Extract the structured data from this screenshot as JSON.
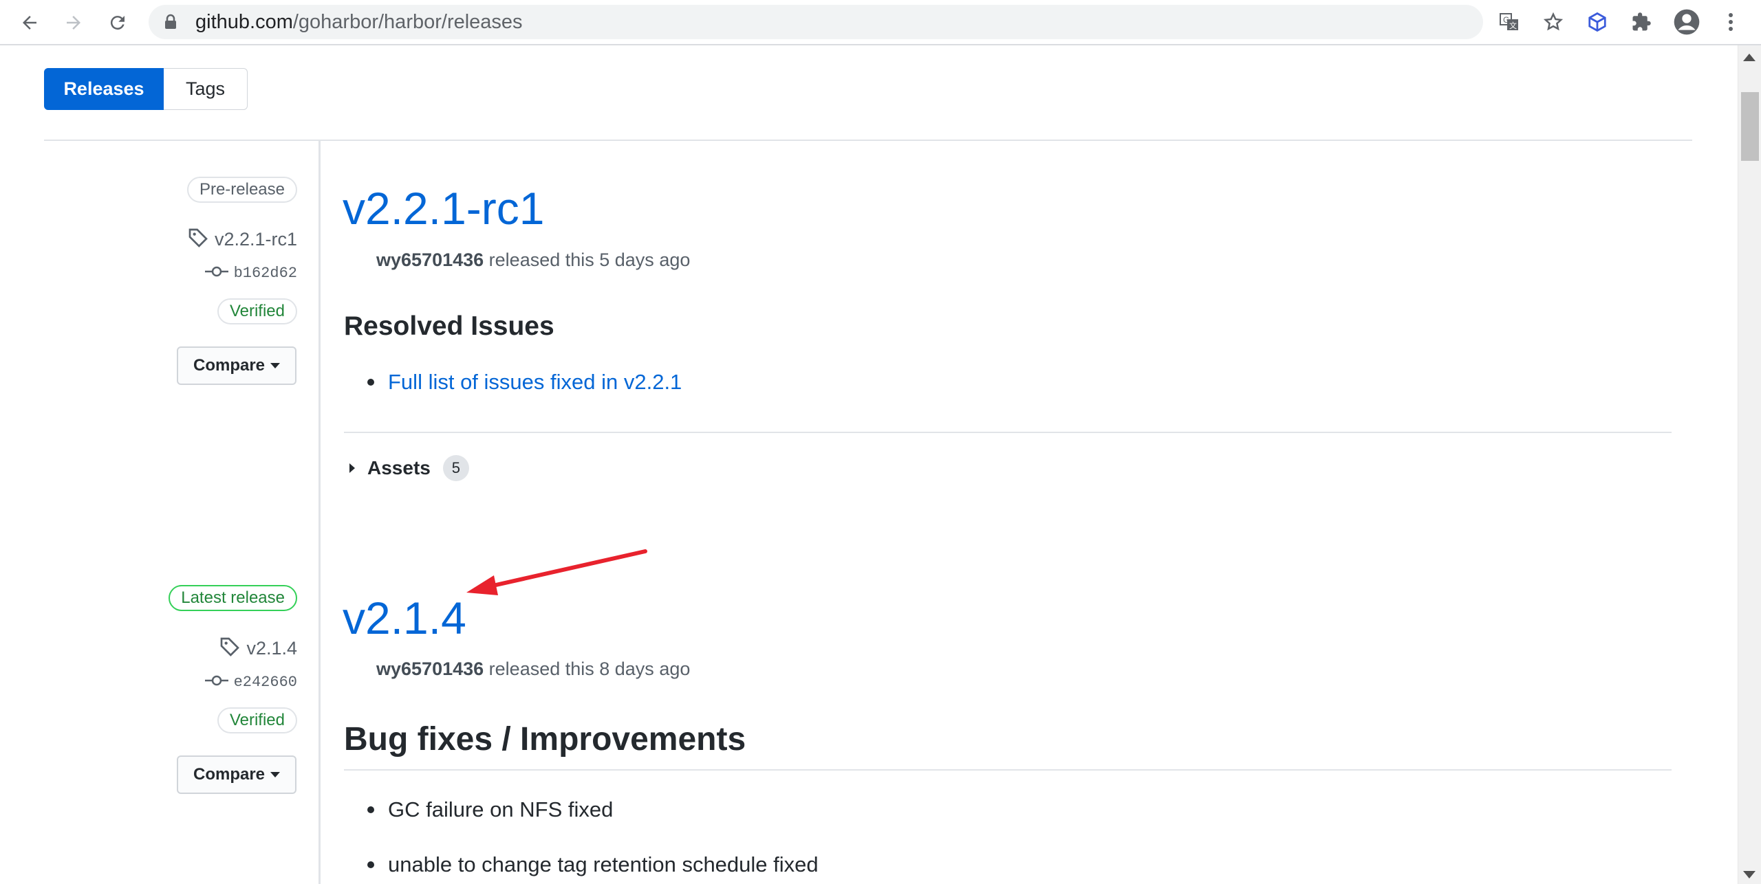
{
  "browser": {
    "url_host": "github.com",
    "url_path": "/goharbor/harbor/releases",
    "icons": [
      "back-arrow-icon",
      "forward-arrow-icon",
      "reload-icon",
      "lock-icon",
      "translate-icon",
      "star-icon",
      "extension-cube-icon",
      "puzzle-icon",
      "profile-icon",
      "kebab-menu-icon"
    ]
  },
  "subnav": {
    "releases_label": "Releases",
    "tags_label": "Tags"
  },
  "releases": [
    {
      "badge": "Pre-release",
      "tag": "v2.2.1-rc1",
      "commit": "b162d62",
      "verified": "Verified",
      "compare": "Compare",
      "title": "v2.2.1-rc1",
      "author": "wy65701436",
      "released": "released this 5 days ago",
      "section_heading": "Resolved Issues",
      "items": [
        "Full list of issues fixed in v2.2.1"
      ],
      "assets_label": "Assets",
      "assets_count": "5"
    },
    {
      "badge": "Latest release",
      "tag": "v2.1.4",
      "commit": "e242660",
      "verified": "Verified",
      "compare": "Compare",
      "title": "v2.1.4",
      "author": "wy65701436",
      "released": "released this 8 days ago",
      "section_heading": "Bug fixes / Improvements",
      "items": [
        "GC failure on NFS fixed",
        "unable to change tag retention schedule fixed"
      ]
    }
  ],
  "colors": {
    "link": "#0366d6",
    "annotation_arrow": "#e8222d",
    "verified": "#22863a"
  }
}
